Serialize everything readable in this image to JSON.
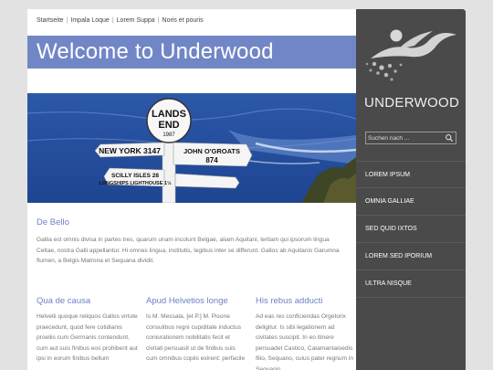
{
  "breadcrumb": [
    "Startseite",
    "Impala Loque",
    "Lorem Suppa",
    "Noris et pouris"
  ],
  "page_title": "Welcome to Underwood",
  "hero_sign": {
    "top": "LANDS",
    "top2": "END",
    "year": "1987",
    "left_arm": "NEW YORK 3147",
    "right_arm_1": "JOHN O'GROATS",
    "right_arm_2": "874",
    "lower_1": "SCILLY ISLES 28",
    "lower_2": "LONGSHIPS LIGHTHOUSE 1½"
  },
  "intro": {
    "title": "De Bello",
    "text": "Gallia est omnis divisa in partes tres, quarum unam incolunt Belgae, aliam Aquitani, tertiam qui ipsorum lingua Celtae, nostra Galli appellantur. Hi omnes lingua, institutis, legibus inter se differunt. Gallos ab Aquitanis Garumna flumen, a Belgis Matrona et Sequana dividit."
  },
  "columns": [
    {
      "title": "Qua de causa",
      "text": "Helvetii quoque reliquos Gallos virtute praecedunt, quod fere cotidianis proeliis cum Germanis contendunt, cum aut suis finibus eos prohibent aut ipsi in eorum finibus bellum"
    },
    {
      "title": "Apud Helvetios longe",
      "text": "Is M. Messala, [et P.] M. Pisone consulibus regni cupiditate inductus coniurationem nobilitatis fecit et civitati persuasit ut de finibus suis cum omnibus copiis exirent: perfacile"
    },
    {
      "title": "His rebus adducti",
      "text": "Ad eas res conficiendas Orgetorix deligitur. Is sibi legationem ad civitates suscipit. In eo itinere persuadet Castico, Catamantaloedis filio, Sequano, cuius pater regnum in Sequanis"
    }
  ],
  "sidebar": {
    "brand": "UNDERWOOD",
    "search_placeholder": "Suchen nach ...",
    "nav": [
      "LOREM IPSUM",
      "OMNIA GALLIAE",
      "SED QUID IXTOS",
      "LOREM SED IPORIUM",
      "ULTRA NISQUE"
    ]
  },
  "colors": {
    "accent": "#7186c6",
    "sidebar": "#4a4a4a",
    "heading": "#6a82c8"
  }
}
